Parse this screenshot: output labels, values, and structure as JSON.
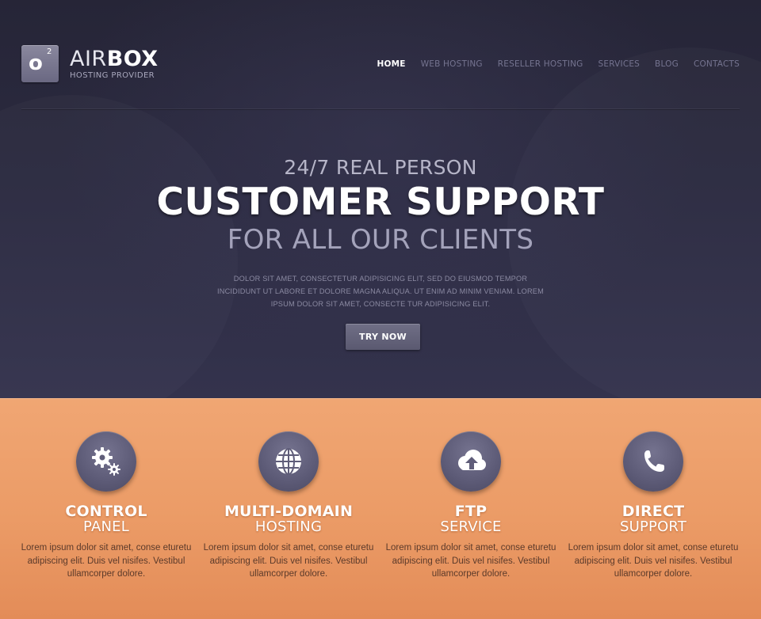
{
  "logo": {
    "mark_letter": "o",
    "mark_sup": "2",
    "name_light": "AIR",
    "name_bold": "BOX",
    "tagline": "HOSTING PROVIDER"
  },
  "nav": {
    "items": [
      {
        "label": "HOME",
        "active": true
      },
      {
        "label": "WEB HOSTING"
      },
      {
        "label": "RESELLER HOSTING"
      },
      {
        "label": "SERVICES"
      },
      {
        "label": "BLOG"
      },
      {
        "label": "CONTACTS"
      }
    ]
  },
  "hero": {
    "line1": "24/7 REAL PERSON",
    "line2": "CUSTOMER SUPPORT",
    "line3": "FOR ALL OUR CLIENTS",
    "text_lines": [
      "DOLOR SIT AMET, CONSECTETUR ADIPISICING ELIT, SED DO EIUSMOD TEMPOR",
      "INCIDIDUNT UT LABORE ET DOLORE MAGNA ALIQUA. UT ENIM AD MINIM VENIAM. LOREM",
      "IPSUM DOLOR SIT AMET, CONSECTE TUR ADIPISICING ELIT."
    ],
    "button": "TRY NOW"
  },
  "features": [
    {
      "icon": "gears-icon",
      "title1": "CONTROL",
      "title2": "PANEL",
      "text_lines": [
        "Lorem ipsum dolor sit amet, conse eturetu",
        "adipiscing elit. Duis vel nisifes. Vestibul",
        "ullamcorper dolore."
      ]
    },
    {
      "icon": "globe-icon",
      "title1": "MULTI-DOMAIN",
      "title2": "HOSTING",
      "text_lines": [
        "Lorem ipsum dolor sit amet, conse eturetu",
        "adipiscing elit. Duis vel nisifes. Vestibul",
        "ullamcorper dolore."
      ]
    },
    {
      "icon": "cloud-upload-icon",
      "title1": "FTP",
      "title2": "SERVICE",
      "text_lines": [
        "Lorem ipsum dolor sit amet, conse eturetu",
        "adipiscing elit. Duis vel nisifes. Vestibul",
        "ullamcorper dolore."
      ]
    },
    {
      "icon": "phone-icon",
      "title1": "DIRECT",
      "title2": "SUPPORT",
      "text_lines": [
        "Lorem ipsum dolor sit amet, conse eturetu",
        "adipiscing elit. Duis vel nisifes. Vestibul",
        "ullamcorper dolore."
      ]
    }
  ],
  "colors": {
    "hero_bg": "#2b2a40",
    "features_bg": "#eb9b66",
    "accent_button": "#656479"
  }
}
